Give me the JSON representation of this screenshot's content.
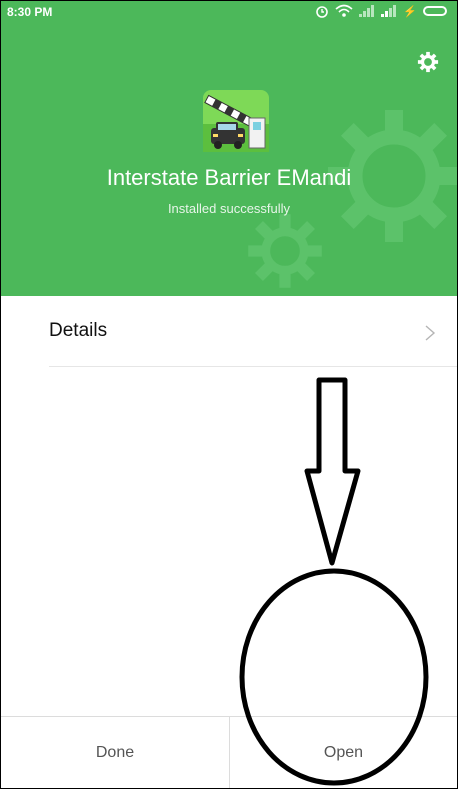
{
  "status_bar": {
    "time": "8:30 PM",
    "icons": [
      "alarm-icon",
      "wifi-icon",
      "signal-icon",
      "signal-icon",
      "battery-icon"
    ]
  },
  "header": {
    "settings_icon": "gear-icon",
    "app_name": "Interstate Barrier EMandi",
    "status_text": "Installed successfully",
    "background_color": "#4cb85a"
  },
  "details": {
    "label": "Details",
    "chevron": "chevron-right-icon"
  },
  "footer": {
    "done_label": "Done",
    "open_label": "Open"
  },
  "annotation": {
    "shapes": [
      "down-arrow",
      "circle"
    ],
    "color": "#000000"
  }
}
